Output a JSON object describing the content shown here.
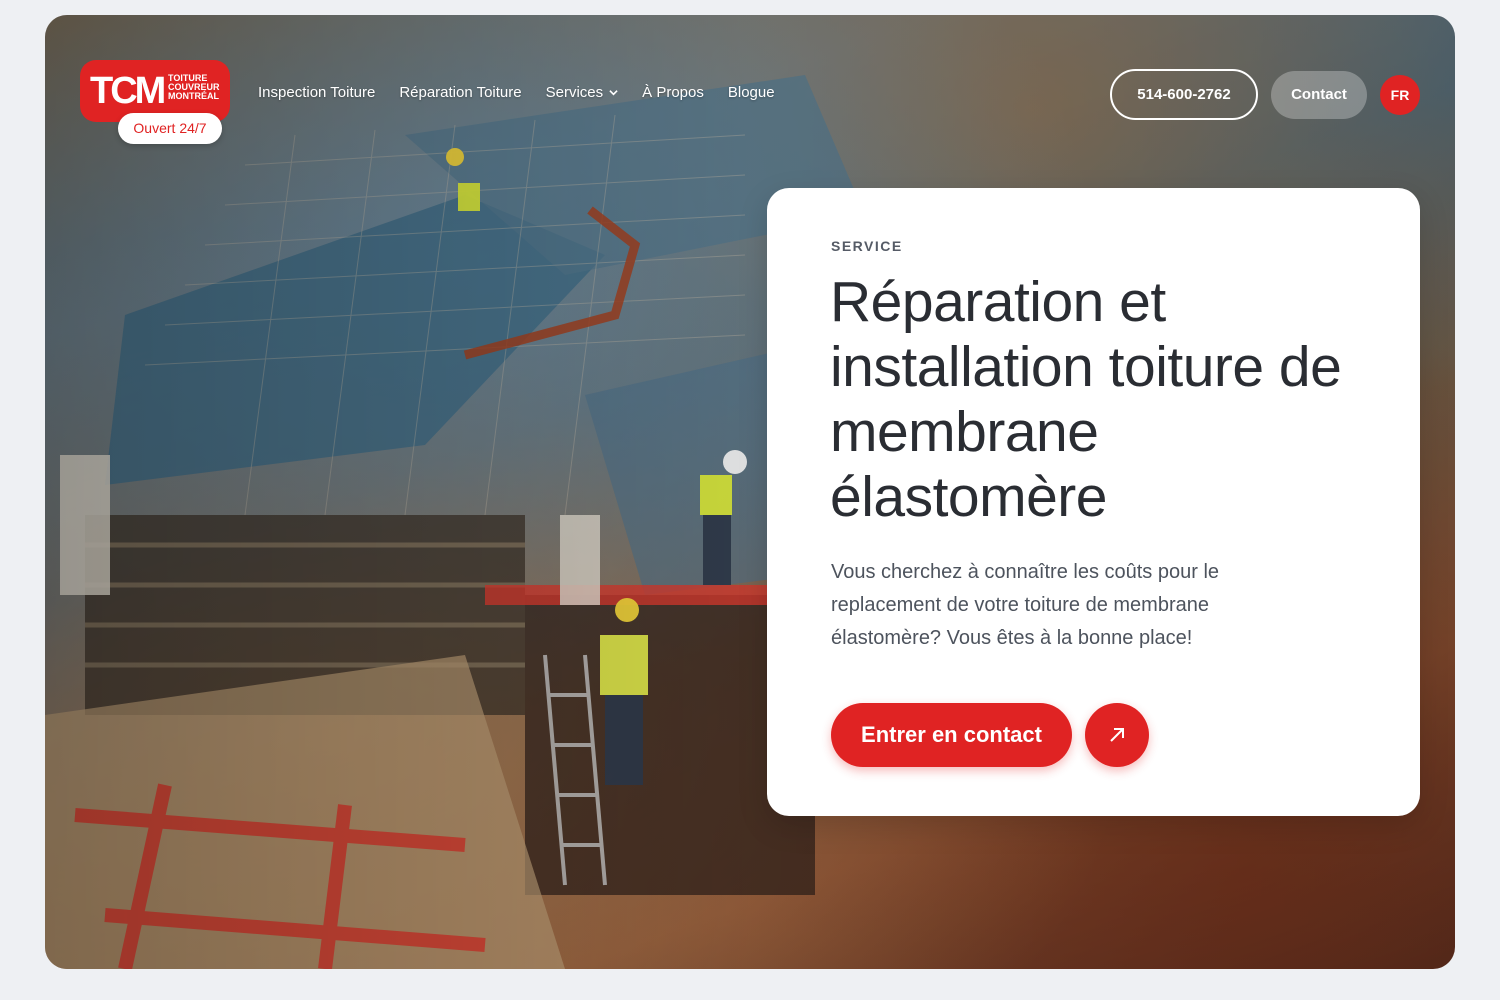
{
  "header": {
    "logo": {
      "mark": "TCM",
      "lines": [
        "TOITURE",
        "COUVREUR",
        "MONTRÉAL"
      ]
    },
    "open_badge": "Ouvert 24/7",
    "nav": [
      {
        "label": "Inspection Toiture"
      },
      {
        "label": "Réparation Toiture"
      },
      {
        "label": "Services",
        "has_dropdown": true
      },
      {
        "label": "À Propos"
      },
      {
        "label": "Blogue"
      }
    ],
    "phone": "514-600-2762",
    "contact": "Contact",
    "lang": "FR"
  },
  "card": {
    "eyebrow": "SERVICE",
    "title": "Réparation et installation toiture de membrane élastomère",
    "lead": "Vous cherchez à connaître les coûts pour le replacement de votre toiture de membrane élastomère? Vous êtes à la bonne place!",
    "cta": "Entrer en contact",
    "cta_icon": "arrow-up-right-icon"
  },
  "colors": {
    "brand": "#e02323",
    "background": "#eef0f3",
    "text_dark": "#2a2d33"
  }
}
